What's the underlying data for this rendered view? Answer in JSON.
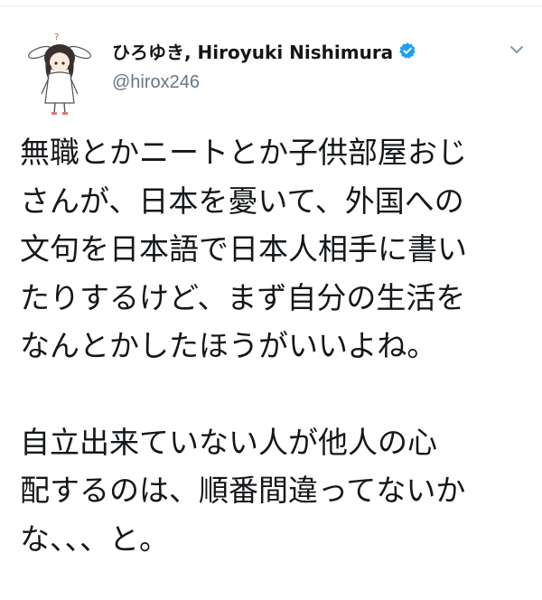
{
  "tweet": {
    "author": {
      "display_name": "ひろゆき, Hiroyuki Nishimura",
      "handle": "@hirox246",
      "verified": true,
      "avatar": "anime-character-bunny-ears-avatar"
    },
    "menu_icon": "chevron-down-icon",
    "paragraphs": [
      "無職とかニートとか子供部屋おじ\nさんが、日本を憂いて、外国への\n文句を日本語で日本人相手に書い\nたりするけど、まず自分の生活を\nなんとかしたほうがいいよね。",
      "自立出来ていない人が他人の心\n配するのは、順番間違ってないか\nな、、、と。"
    ]
  },
  "colors": {
    "text": "#14171a",
    "secondary": "#657786",
    "verified_blue": "#1da1f2",
    "divider": "#e6ecf0"
  }
}
